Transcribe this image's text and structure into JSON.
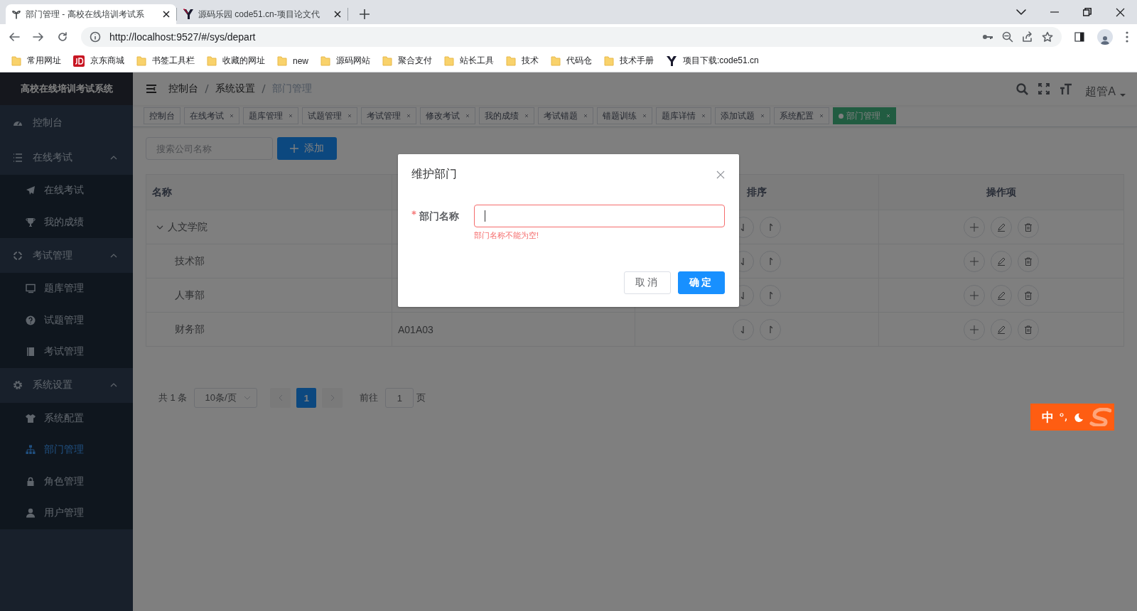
{
  "browser": {
    "tabs": [
      {
        "title": "部门管理 - 高校在线培训考试系",
        "selected": true,
        "kind": "app"
      },
      {
        "title": "源码乐园 code51.cn-项目论文代",
        "selected": false,
        "kind": "site"
      }
    ],
    "url": "http://localhost:9527/#/sys/depart",
    "bookmarks": [
      {
        "label": "常用网址",
        "kind": "folder"
      },
      {
        "label": "京东商城",
        "kind": "jd"
      },
      {
        "label": "书签工具栏",
        "kind": "folder"
      },
      {
        "label": "收藏的网址",
        "kind": "folder"
      },
      {
        "label": "new",
        "kind": "folder"
      },
      {
        "label": "源码网站",
        "kind": "folder"
      },
      {
        "label": "聚合支付",
        "kind": "folder"
      },
      {
        "label": "站长工具",
        "kind": "folder"
      },
      {
        "label": "技术",
        "kind": "folder"
      },
      {
        "label": "代码仓",
        "kind": "folder"
      },
      {
        "label": "技术手册",
        "kind": "folder"
      },
      {
        "label": "项目下载:code51.cn",
        "kind": "site"
      }
    ]
  },
  "sidebar": {
    "title": "高校在线培训考试系统",
    "items": [
      {
        "label": "控制台",
        "selected": false
      },
      {
        "label": "在线考试",
        "expanded": true,
        "children": [
          {
            "label": "在线考试",
            "selected": false
          },
          {
            "label": "我的成绩",
            "selected": false
          }
        ]
      },
      {
        "label": "考试管理",
        "expanded": true,
        "children": [
          {
            "label": "题库管理",
            "selected": false
          },
          {
            "label": "试题管理",
            "selected": false
          },
          {
            "label": "考试管理",
            "selected": false
          }
        ]
      },
      {
        "label": "系统设置",
        "expanded": true,
        "children": [
          {
            "label": "系统配置",
            "selected": false
          },
          {
            "label": "部门管理",
            "selected": true
          },
          {
            "label": "角色管理",
            "selected": false
          },
          {
            "label": "用户管理",
            "selected": false
          }
        ]
      }
    ]
  },
  "header": {
    "breadcrumb": [
      "控制台",
      "系统设置",
      "部门管理"
    ],
    "user": "超管A"
  },
  "tags": [
    {
      "label": "控制台",
      "closable": false,
      "selected": false
    },
    {
      "label": "在线考试",
      "closable": true,
      "selected": false
    },
    {
      "label": "题库管理",
      "closable": true,
      "selected": false
    },
    {
      "label": "试题管理",
      "closable": true,
      "selected": false
    },
    {
      "label": "考试管理",
      "closable": true,
      "selected": false
    },
    {
      "label": "修改考试",
      "closable": true,
      "selected": false
    },
    {
      "label": "我的成绩",
      "closable": true,
      "selected": false
    },
    {
      "label": "考试错题",
      "closable": true,
      "selected": false
    },
    {
      "label": "错题训练",
      "closable": true,
      "selected": false
    },
    {
      "label": "题库详情",
      "closable": true,
      "selected": false
    },
    {
      "label": "添加试题",
      "closable": true,
      "selected": false
    },
    {
      "label": "系统配置",
      "closable": true,
      "selected": false
    },
    {
      "label": "部门管理",
      "closable": true,
      "selected": true
    }
  ],
  "toolbar": {
    "search": {
      "placeholder": "搜索公司名称"
    },
    "add_button": "添加"
  },
  "table": {
    "columns": {
      "name": "名称",
      "sort": "排序",
      "actions": "操作项"
    },
    "rows": [
      {
        "name": "人文学院",
        "expanded": true,
        "children": [
          {
            "name": "技术部"
          },
          {
            "name": "人事部"
          },
          {
            "name": "财务部",
            "column_2": "A01A03"
          }
        ]
      }
    ]
  },
  "pagination": {
    "total": "共 1 条",
    "page_size": "10条/页",
    "pages": [
      {
        "label": "1",
        "selected": true
      }
    ],
    "goto_label": "前往",
    "goto_value": "1",
    "goto_suffix": "页"
  },
  "dialog": {
    "title": "维护部门",
    "field": {
      "label": "部门名称",
      "required": true,
      "focused": true,
      "error": "部门名称不能为空!"
    },
    "buttons": [
      {
        "label": "取消",
        "kind": "default"
      },
      {
        "label": "确定",
        "kind": "primary"
      }
    ]
  },
  "ime": {
    "mode": "中"
  }
}
